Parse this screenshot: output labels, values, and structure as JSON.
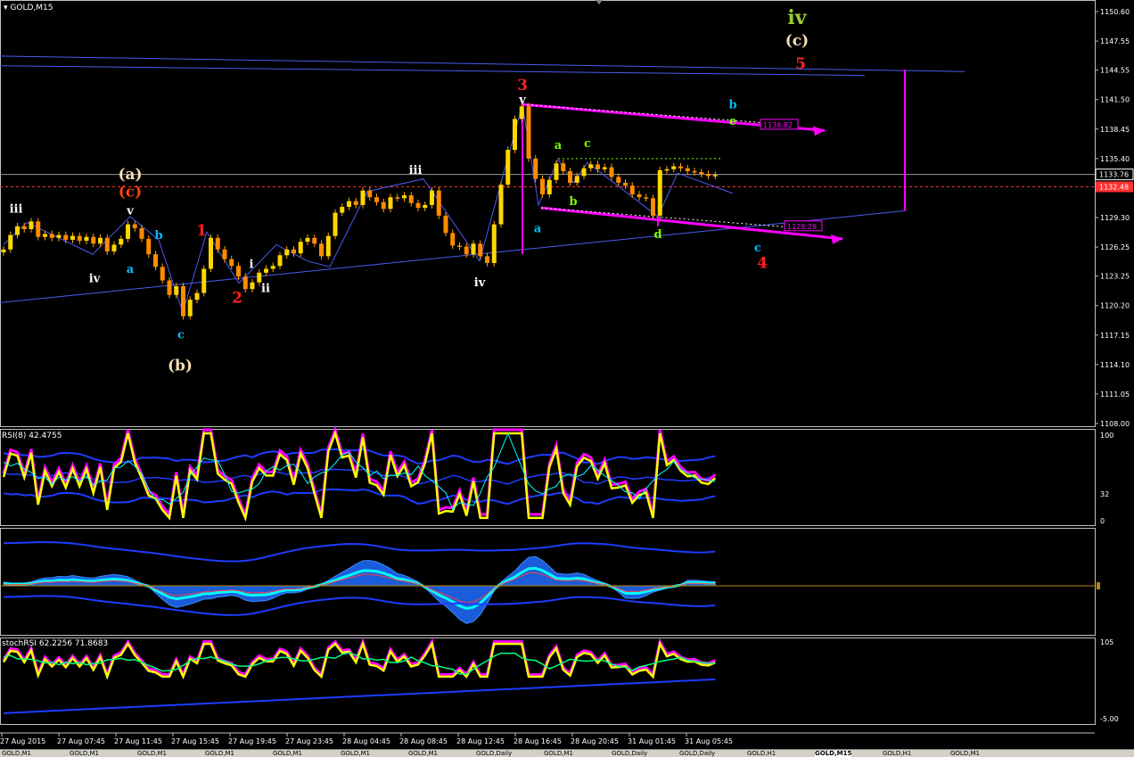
{
  "window": {
    "symbol_label": "GOLD,M15"
  },
  "colors": {
    "background": "#000000",
    "candle": "#ff8c00",
    "trendline": "#4a5cf0",
    "channel": "#ff00ff",
    "bid_line": "#ff3030",
    "price_tag_current": "#1e1e1e"
  },
  "chart_data": [
    {
      "type": "line",
      "panel": "price",
      "title": "GOLD,M15",
      "ylim": [
        1108.0,
        1150.6
      ],
      "y_ticks": [
        "1150.60",
        "1147.55",
        "1144.55",
        "1141.50",
        "1138.45",
        "1135.40",
        "1132.35",
        "1129.30",
        "1126.25",
        "1123.25",
        "1120.20",
        "1117.15",
        "1114.10",
        "1111.05",
        "1108.00"
      ],
      "x_ticks": [
        "27 Aug 2015",
        "27 Aug 07:45",
        "27 Aug 11:45",
        "27 Aug 15:45",
        "27 Aug 19:45",
        "27 Aug 23:45",
        "28 Aug 04:45",
        "28 Aug 08:45",
        "28 Aug 12:45",
        "28 Aug 16:45",
        "28 Aug 20:45",
        "31 Aug 01:45",
        "31 Aug 05:45"
      ],
      "series": [
        {
          "values": [
            1126.0,
            1127.5,
            1128.4,
            1128.1,
            1128.9,
            1127.3,
            1127.6,
            1127.2,
            1127.5,
            1127.0,
            1127.4,
            1126.9,
            1127.3,
            1126.6,
            1127.2,
            1125.8,
            1126.5,
            1127.1,
            1128.6,
            1128.2,
            1127.1,
            1125.5,
            1124.2,
            1122.8,
            1121.3,
            1122.2,
            1119.1,
            1120.8,
            1121.5,
            1124.0,
            1127.2,
            1126.0,
            1125.0,
            1124.3,
            1123.2,
            1121.9,
            1122.6,
            1123.6,
            1124.0,
            1124.3,
            1125.4,
            1126.0,
            1125.6,
            1126.8,
            1127.2,
            1126.6,
            1125.3,
            1127.4,
            1129.8,
            1130.4,
            1131.0,
            1130.6,
            1132.1,
            1131.4,
            1130.9,
            1130.2,
            1131.4,
            1131.3,
            1131.6,
            1130.8,
            1130.3,
            1130.6,
            1132.1,
            1129.5,
            1127.7,
            1126.4,
            1126.3,
            1125.5,
            1126.6,
            1125.3,
            1124.6,
            1128.6,
            1132.7,
            1136.3,
            1139.5,
            1140.8,
            1135.4,
            1133.3,
            1131.7,
            1133.2,
            1134.9,
            1134.1,
            1132.9,
            1133.6,
            1134.4,
            1134.8,
            1134.3,
            1134.5,
            1133.5,
            1132.9,
            1132.6,
            1131.7,
            1131.4,
            1131.3,
            1129.5,
            1134.2,
            1134.3,
            1134.6,
            1134.4,
            1134.1,
            1134.0,
            1133.8,
            1133.6,
            1133.7
          ]
        }
      ]
    },
    {
      "type": "line",
      "panel": "rsi",
      "title": "RSI(8) 42.4755",
      "y_ticks": [
        "100",
        "32",
        "0"
      ]
    },
    {
      "type": "line",
      "panel": "macd",
      "title": "",
      "y_ticks": [
        "0"
      ]
    },
    {
      "type": "line",
      "panel": "stoch",
      "title": "stochRSI 62.2256 71.8683",
      "y_ticks": [
        "105",
        "-5.00"
      ]
    }
  ],
  "price_tags": {
    "current": "1133.76",
    "bid": "1132.48",
    "upper_channel": "1138.82",
    "lower_channel": "1128.29"
  },
  "wave_labels": [
    {
      "text": "iii",
      "color": "#ffffff",
      "price": 1130.2,
      "x": 18
    },
    {
      "text": "(a)",
      "color": "#f5deb3",
      "price": 1133.8,
      "x": 146
    },
    {
      "text": "(c)",
      "color": "#ff4500",
      "price": 1132.0,
      "x": 146
    },
    {
      "text": "v",
      "color": "#ffffff",
      "price": 1130.0,
      "x": 146
    },
    {
      "text": "b",
      "color": "#00bfff",
      "price": 1127.5,
      "x": 178
    },
    {
      "text": "1",
      "color": "#ff2020",
      "price": 1128.0,
      "x": 226
    },
    {
      "text": "a",
      "color": "#00bfff",
      "price": 1124.0,
      "x": 146
    },
    {
      "text": "iv",
      "color": "#ffffff",
      "price": 1123.0,
      "x": 106
    },
    {
      "text": "i",
      "color": "#ffffff",
      "price": 1124.5,
      "x": 282
    },
    {
      "text": "ii",
      "color": "#ffffff",
      "price": 1122.0,
      "x": 298
    },
    {
      "text": "2",
      "color": "#ff2020",
      "price": 1121.0,
      "x": 266
    },
    {
      "text": "c",
      "color": "#00bfff",
      "price": 1117.2,
      "x": 203
    },
    {
      "text": "(b)",
      "color": "#f5deb3",
      "price": 1114.0,
      "x": 202
    },
    {
      "text": "iii",
      "color": "#ffffff",
      "price": 1134.2,
      "x": 466
    },
    {
      "text": "iv",
      "color": "#ffffff",
      "price": 1122.6,
      "x": 538
    },
    {
      "text": "3",
      "color": "#ff2020",
      "price": 1143.0,
      "x": 586
    },
    {
      "text": "v",
      "color": "#ffffff",
      "price": 1141.5,
      "x": 586
    },
    {
      "text": "a",
      "color": "#7fff00",
      "price": 1136.8,
      "x": 626
    },
    {
      "text": "c",
      "color": "#7fff00",
      "price": 1137.0,
      "x": 659
    },
    {
      "text": "b",
      "color": "#7fff00",
      "price": 1131.0,
      "x": 643
    },
    {
      "text": "a",
      "color": "#00bfff",
      "price": 1128.2,
      "x": 603
    },
    {
      "text": "d",
      "color": "#7fff00",
      "price": 1127.6,
      "x": 738
    },
    {
      "text": "b",
      "color": "#00bfff",
      "price": 1141.0,
      "x": 822
    },
    {
      "text": "e",
      "color": "#7fff00",
      "price": 1139.3,
      "x": 822
    },
    {
      "text": "c",
      "color": "#00bfff",
      "price": 1126.2,
      "x": 850
    },
    {
      "text": "4",
      "color": "#ff2020",
      "price": 1124.6,
      "x": 855
    },
    {
      "text": "iv",
      "color": "#9acd32",
      "price": 1150.0,
      "x": 894
    },
    {
      "text": "(c)",
      "color": "#f5deb3",
      "price": 1147.6,
      "x": 894
    },
    {
      "text": "5",
      "color": "#ff2020",
      "price": 1145.2,
      "x": 898
    }
  ],
  "tabs": [
    "GOLD,M1",
    "GOLD,M1",
    "GOLD,M1",
    "GOLD,M1",
    "GOLD,M1",
    "GOLD,M1",
    "GOLD,M1",
    "GOLD,Daily",
    "GOLD,M1",
    "GOLD,Daily",
    "GOLD,Daily",
    "GOLD,H1",
    "GOLD,M15",
    "GOLD,H1",
    "GOLD,M1"
  ]
}
